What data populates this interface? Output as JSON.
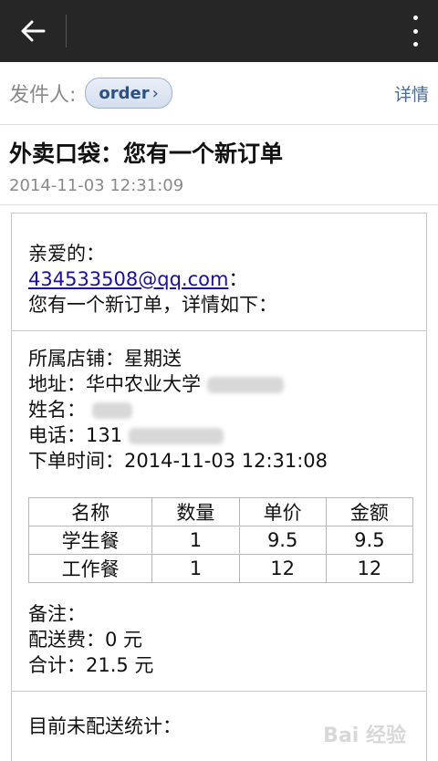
{
  "sender": {
    "label": "发件人:",
    "chip": "order",
    "details": "详情"
  },
  "email": {
    "subject": "外卖口袋：您有一个新订单",
    "date": "2014-11-03 12:31:09"
  },
  "body": {
    "greeting": "亲爱的：",
    "email_link": "434533508@qq.com",
    "email_suffix": "：",
    "intro": "您有一个新订单，详情如下：",
    "store": "所属店铺：星期送",
    "address_label": "地址：华中农业大学",
    "name_label": "姓名：",
    "phone_label": "电话：131",
    "order_time": "下单时间：2014-11-03 12:31:08",
    "table": {
      "headers": [
        "名称",
        "数量",
        "单价",
        "金额"
      ],
      "rows": [
        [
          "学生餐",
          "1",
          "9.5",
          "9.5"
        ],
        [
          "工作餐",
          "1",
          "12",
          "12"
        ]
      ]
    },
    "remark": "备注：",
    "delivery_fee": "配送费：0 元",
    "total": "合计：21.5 元",
    "stats": "目前未配送统计："
  },
  "watermark": "Bai 经验"
}
